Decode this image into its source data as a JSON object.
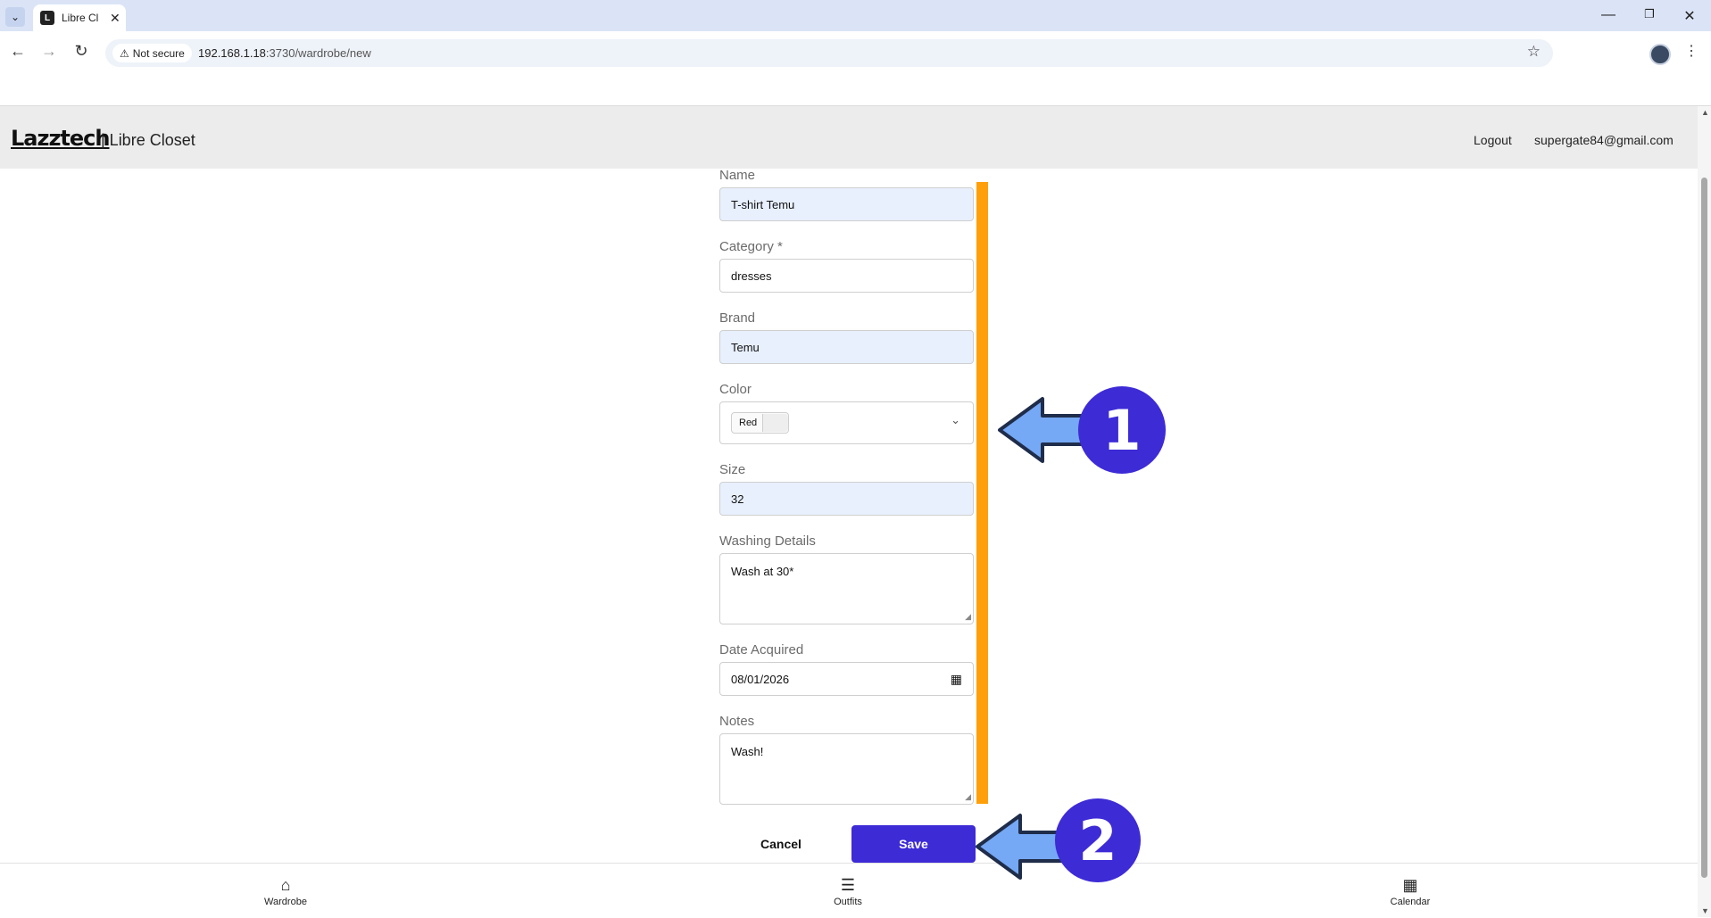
{
  "browser": {
    "tab_title": "Libre Cl",
    "tab_close": "✕",
    "window_controls": [
      "—",
      "❐",
      "✕"
    ],
    "security_label": "Not secure",
    "url_host": "192.168.1.18",
    "url_path": ":3730/wardrobe/new"
  },
  "header": {
    "logo_text": "Lazztech",
    "app_title": "| Libre Closet",
    "logout": "Logout",
    "email": "supergate84@gmail.com"
  },
  "form": {
    "name": {
      "label": "Name",
      "value": "T-shirt Temu"
    },
    "category": {
      "label": "Category *",
      "value": "dresses"
    },
    "brand": {
      "label": "Brand",
      "value": "Temu"
    },
    "color": {
      "label": "Color",
      "value": "Red"
    },
    "size": {
      "label": "Size",
      "value": "32"
    },
    "washing": {
      "label": "Washing Details",
      "value": "Wash at 30*"
    },
    "date": {
      "label": "Date Acquired",
      "value": "08/01/2026"
    },
    "notes": {
      "label": "Notes",
      "value": "Wash!"
    },
    "cancel": "Cancel",
    "save": "Save"
  },
  "bottom_nav": {
    "wardrobe": "Wardrobe",
    "outfits": "Outfits",
    "calendar": "Calendar"
  },
  "annotations": {
    "step1": "1",
    "step2": "2",
    "arrow_color": "#75a8f5",
    "badge_color": "#3d2bd6",
    "highlight_color": "#ff9f0a"
  }
}
